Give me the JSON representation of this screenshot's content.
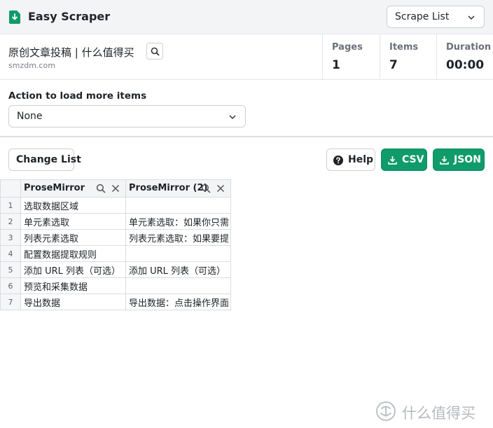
{
  "app": {
    "title": "Easy Scraper"
  },
  "mode_select": {
    "value": "Scrape List"
  },
  "site": {
    "title": "原创文章投稿 | 什么值得买",
    "domain": "smzdm.com"
  },
  "stats": {
    "pages_label": "Pages",
    "pages_value": "1",
    "items_label": "Items",
    "items_value": "7",
    "duration_label": "Duration",
    "duration_value": "00:00"
  },
  "action": {
    "label": "Action to load more items",
    "value": "None"
  },
  "toolbar": {
    "change_list": "Change List",
    "help": "Help",
    "csv": "CSV",
    "json": "JSON"
  },
  "table": {
    "columns": [
      "ProseMirror",
      "ProseMirror (2)"
    ],
    "rows": [
      {
        "n": "1",
        "c1": "选取数据区域",
        "c2": ""
      },
      {
        "n": "2",
        "c1": "单元素选取",
        "c2": "单元素选取：如果你只需"
      },
      {
        "n": "3",
        "c1": "列表元素选取",
        "c2": "列表元素选取：如果要提"
      },
      {
        "n": "4",
        "c1": "配置数据提取规则",
        "c2": ""
      },
      {
        "n": "5",
        "c1": "添加 URL 列表（可选）",
        "c2": "添加 URL 列表（可选）"
      },
      {
        "n": "6",
        "c1": "预览和采集数据",
        "c2": ""
      },
      {
        "n": "7",
        "c1": "导出数据",
        "c2": "导出数据：点击操作界面"
      }
    ]
  },
  "watermark": {
    "text": "什么值得买"
  },
  "colors": {
    "accent_green": "#0f9b6a",
    "border": "#d9dce1"
  }
}
